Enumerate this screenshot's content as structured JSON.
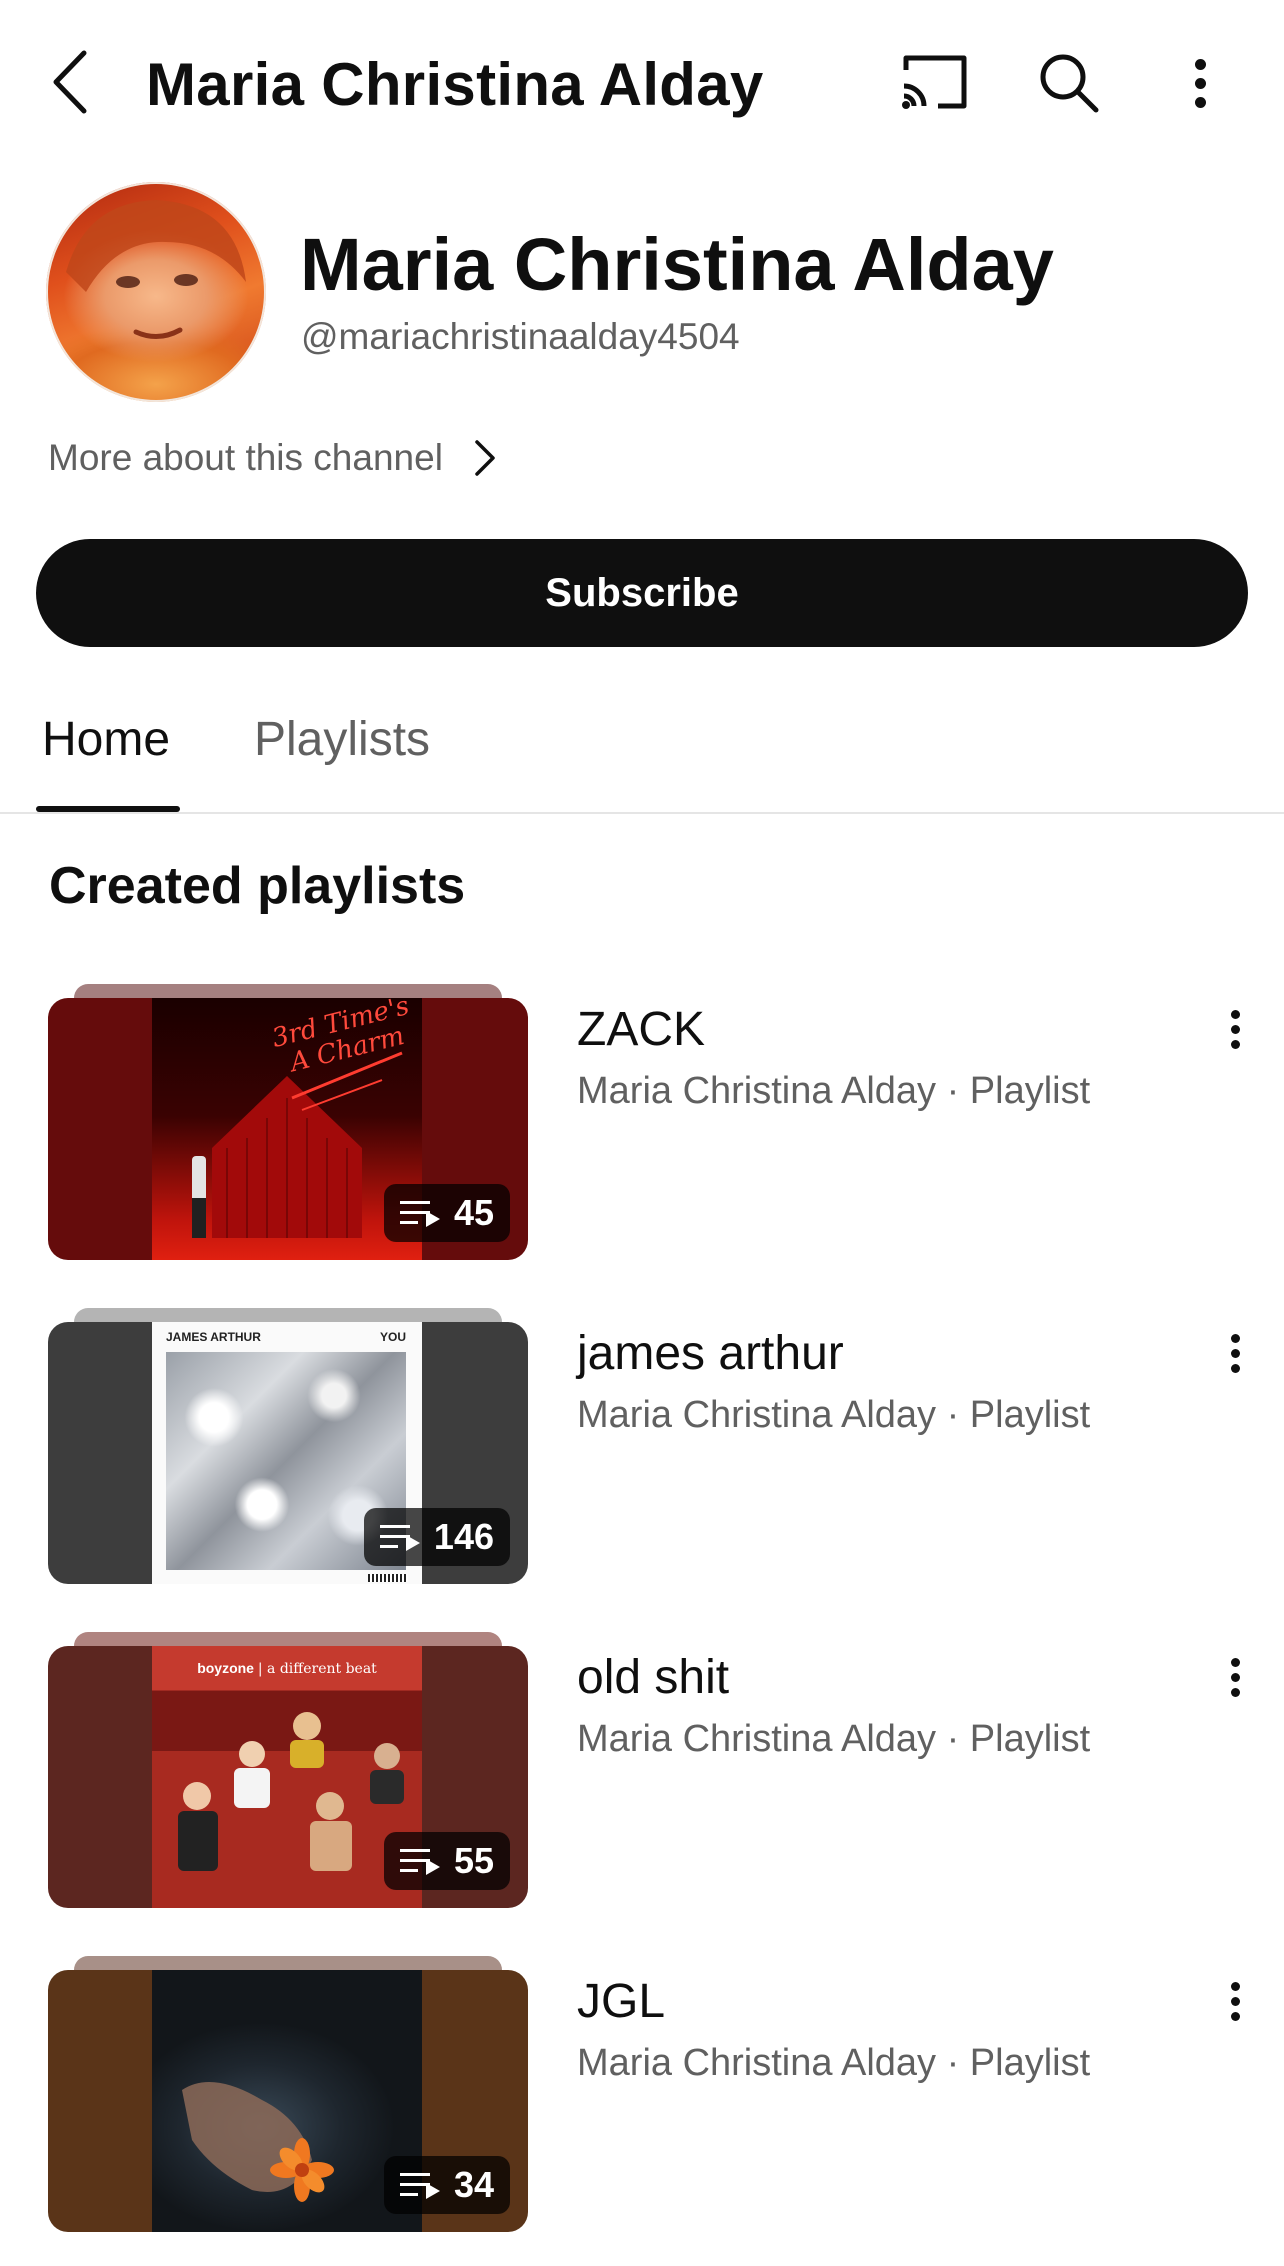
{
  "topbar": {
    "title": "Maria Christina Alday",
    "back_icon": "back-arrow-icon",
    "cast_icon": "cast-icon",
    "search_icon": "search-icon",
    "more_icon": "more-vert-icon"
  },
  "channel": {
    "name": "Maria Christina Alday",
    "handle": "@mariachristinaalday4504",
    "more_about": "More about this channel",
    "subscribe_label": "Subscribe"
  },
  "tabs": [
    {
      "label": "Home",
      "selected": true
    },
    {
      "label": "Playlists",
      "selected": false
    }
  ],
  "section": {
    "title": "Created playlists"
  },
  "playlists": [
    {
      "title": "ZACK",
      "meta": "Maria Christina Alday · Playlist",
      "count": "45",
      "art_text": "3rd Time's A Charm"
    },
    {
      "title": "james arthur",
      "meta": "Maria Christina Alday · Playlist",
      "count": "146",
      "art_left_text": "JAMES ARTHUR",
      "art_right_text": "YOU"
    },
    {
      "title": "old shit",
      "meta": "Maria Christina Alday · Playlist",
      "count": "55",
      "art_brand": "boyzone",
      "art_subtitle": "a different beat"
    },
    {
      "title": "JGL",
      "meta": "Maria Christina Alday · Playlist",
      "count": "34"
    }
  ],
  "colors": {
    "text_primary": "#0f0f0f",
    "text_secondary": "#606060",
    "subscribe_bg": "#0f0f0f",
    "subscribe_text": "#ffffff",
    "divider": "#e5e5e5"
  }
}
